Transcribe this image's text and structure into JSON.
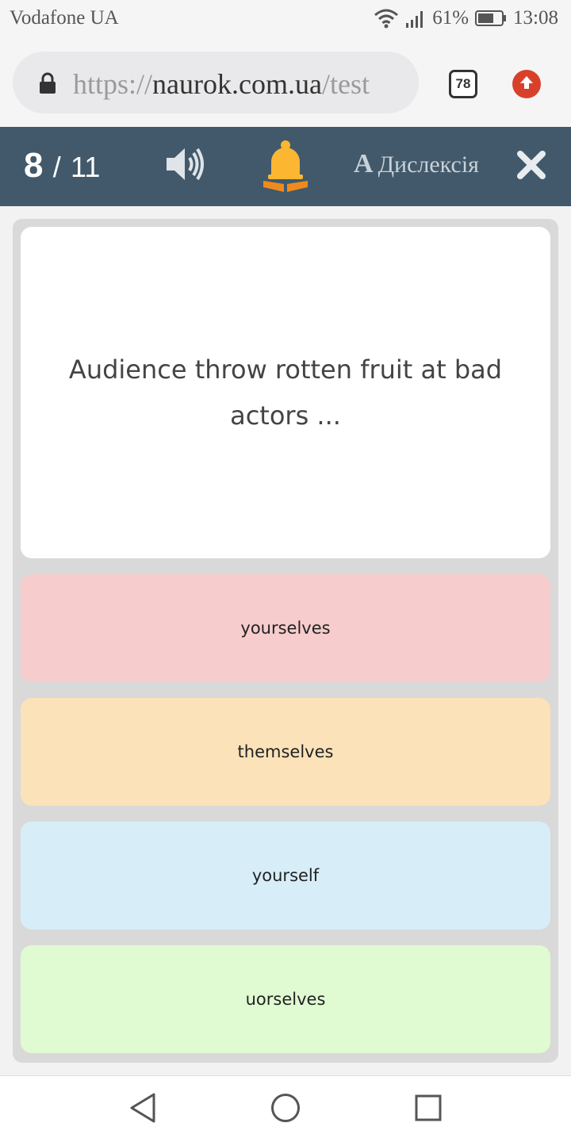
{
  "status_bar": {
    "carrier": "Vodafone UA",
    "battery": "61%",
    "time": "13:08"
  },
  "browser": {
    "url_scheme": "https://",
    "url_host": "naurok.com.ua",
    "url_path": "/test",
    "tabs_count": "78"
  },
  "header": {
    "current": "8",
    "separator": "/",
    "total": "11",
    "dyslexia_letter": "A",
    "dyslexia_label": "Дислексія"
  },
  "question": {
    "text": "Audience throw rotten fruit at bad actors ..."
  },
  "answers": [
    {
      "label": "yourselves",
      "color": "#f6cccc"
    },
    {
      "label": "themselves",
      "color": "#fbe2b9"
    },
    {
      "label": "yourself",
      "color": "#d7eef9"
    },
    {
      "label": "uorselves",
      "color": "#e0fbd1"
    }
  ],
  "colors": {
    "header_bg": "#41596b",
    "bell_primary": "#fbb731",
    "bell_accent": "#f08a1c",
    "update_red": "#d9402b"
  }
}
